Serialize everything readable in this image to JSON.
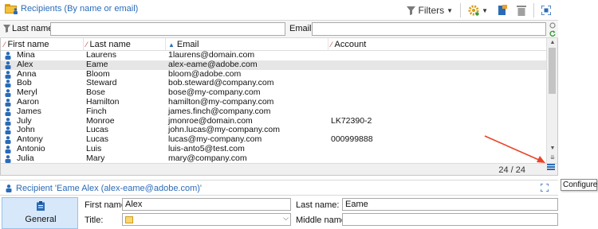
{
  "header": {
    "title": "Recipients (By name or email)",
    "filters_label": "Filters"
  },
  "filter": {
    "lastname_label": "Last name:",
    "lastname_value": "",
    "email_label": "Email:",
    "email_value": ""
  },
  "grid": {
    "columns": [
      "First name",
      "Last name",
      "Email",
      "Account"
    ],
    "rows": [
      {
        "first": "Mina",
        "last": "Laurens",
        "email": "1laurens@domain.com",
        "account": ""
      },
      {
        "first": "Alex",
        "last": "Eame",
        "email": "alex-eame@adobe.com",
        "account": ""
      },
      {
        "first": "Anna",
        "last": "Bloom",
        "email": "bloom@adobe.com",
        "account": ""
      },
      {
        "first": "Bob",
        "last": "Steward",
        "email": "bob.steward@company.com",
        "account": ""
      },
      {
        "first": "Meryl",
        "last": "Bose",
        "email": "bose@my-company.com",
        "account": ""
      },
      {
        "first": "Aaron",
        "last": "Hamilton",
        "email": "hamilton@my-company.com",
        "account": ""
      },
      {
        "first": "James",
        "last": "Finch",
        "email": "james.finch@company.com",
        "account": ""
      },
      {
        "first": "July",
        "last": "Monroe",
        "email": "jmonroe@domain.com",
        "account": "LK72390-2"
      },
      {
        "first": "John",
        "last": "Lucas",
        "email": "john.lucas@my-company.com",
        "account": ""
      },
      {
        "first": "Antony",
        "last": "Lucas",
        "email": "lucas@my-company.com",
        "account": "000999888"
      },
      {
        "first": "Antonio",
        "last": "Luis",
        "email": "luis-anto5@test.com",
        "account": ""
      },
      {
        "first": "Julia",
        "last": "Mary",
        "email": "mary@company.com",
        "account": ""
      }
    ],
    "selected_index": 1,
    "count": "24 / 24"
  },
  "tooltip": "Configure list",
  "detail": {
    "title": "Recipient 'Eame Alex (alex-eame@adobe.com)'",
    "tab_general": "General",
    "first_name_label": "First name:",
    "first_name_value": "Alex",
    "last_name_label": "Last name:",
    "last_name_value": "Eame",
    "title_label": "Title:",
    "middle_name_label": "Middle name:",
    "middle_name_value": ""
  },
  "colors": {
    "accent": "#2a6bb8",
    "annotation": "#e8442a",
    "selected_row": "#e6e6e6",
    "general_tab": "#d7e8fa"
  }
}
